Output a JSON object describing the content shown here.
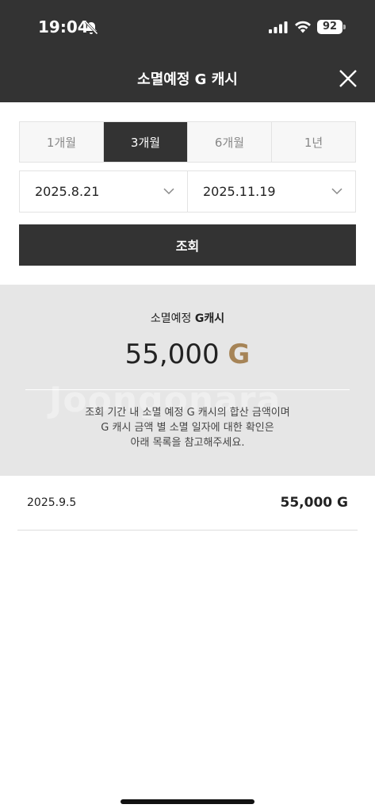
{
  "status_bar": {
    "time": "19:04",
    "battery": "92"
  },
  "header": {
    "title": "소멸예정 G 캐시"
  },
  "period_tabs": [
    {
      "label": "1개월",
      "active": false
    },
    {
      "label": "3개월",
      "active": true
    },
    {
      "label": "6개월",
      "active": false
    },
    {
      "label": "1년",
      "active": false
    }
  ],
  "date_range": {
    "start": "2025.8.21",
    "end": "2025.11.19"
  },
  "query_button": {
    "label": "조회"
  },
  "summary": {
    "label_prefix": "소멸예정 ",
    "label_strong": "G캐시",
    "amount": "55,000",
    "unit": "G",
    "watermark": "Joongonara",
    "note_lines": [
      "조회 기간 내 소멸 예정 G 캐시의 합산 금액이며",
      "G 캐시 금액 별 소멸 일자에 대한 확인은",
      "아래 목록을 참고해주세요."
    ]
  },
  "list": [
    {
      "date": "2025.9.5",
      "amount": "55,000 G"
    }
  ],
  "colors": {
    "header_bg": "#333333",
    "accent_gold": "#a68457",
    "summary_bg": "#e6e6e6"
  }
}
